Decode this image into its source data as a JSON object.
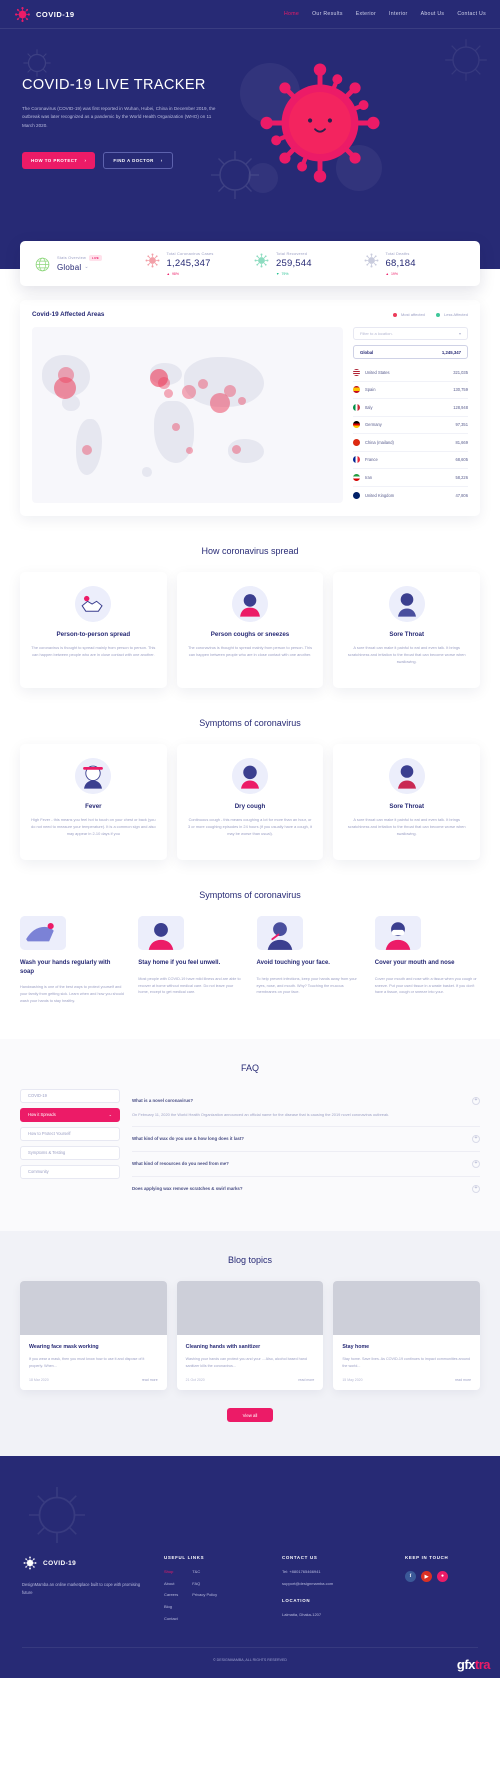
{
  "nav": {
    "brand": "COVID-19",
    "logo_icon": "virus-icon",
    "links": [
      {
        "label": "Home",
        "active": true
      },
      {
        "label": "Our Results",
        "active": false
      },
      {
        "label": "Exterior",
        "active": false
      },
      {
        "label": "Interior",
        "active": false
      },
      {
        "label": "About Us",
        "active": false
      },
      {
        "label": "Contact Us",
        "active": false
      }
    ]
  },
  "hero": {
    "title": "COVID-19 LIVE TRACKER",
    "subtitle": "The Coronavirus (COVID-19) was first reported in Wuhan, Hubei, China in December 2019, the outbreak was later recognized as a pandemic by the World Health Organization (WHO) on 11 March 2020.",
    "primary_button": "HOW TO PROTECT",
    "secondary_button": "FIND A DOCTOR",
    "chevron": "›"
  },
  "stats": {
    "overview_label": "Stats Overview",
    "live_badge": "LIVE",
    "region": "Global",
    "region_caret": "⌄",
    "items": [
      {
        "label": "Total Coronavirus Cases",
        "value": "1,245,347",
        "delta": "98%",
        "direction": "up",
        "icon": "virus-red-icon"
      },
      {
        "label": "Total Recovered",
        "value": "259,544",
        "delta": "79%",
        "direction": "down",
        "icon": "virus-green-icon"
      },
      {
        "label": "Total Deaths",
        "value": "68,184",
        "delta": "19%",
        "direction": "up",
        "icon": "virus-gray-icon"
      }
    ],
    "globe_icon": "globe-icon"
  },
  "map": {
    "title": "Covid-19 Affected Areas",
    "legend": [
      {
        "label": "Most affected",
        "color": "#ec3c5a"
      },
      {
        "label": "Less Affected",
        "color": "#3fc79a"
      }
    ],
    "filter_placeholder": "Filter to a location.",
    "global_row_label": "Global",
    "global_row_value": "1,245,347",
    "countries": [
      {
        "name": "United States",
        "value": "321,035",
        "flag": "us-flag"
      },
      {
        "name": "Spain",
        "value": "130,759",
        "flag": "es-flag"
      },
      {
        "name": "Italy",
        "value": "128,948",
        "flag": "it-flag"
      },
      {
        "name": "Germany",
        "value": "97,351",
        "flag": "de-flag"
      },
      {
        "name": "China (mailand)",
        "value": "81,669",
        "flag": "cn-flag"
      },
      {
        "name": "France",
        "value": "68,605",
        "flag": "fr-flag"
      },
      {
        "name": "Iran",
        "value": "58,226",
        "flag": "ir-flag"
      },
      {
        "name": "United Kingdom",
        "value": "47,806",
        "flag": "gb-flag"
      }
    ]
  },
  "spread": {
    "heading": "How coronavirus spread",
    "cards": [
      {
        "title": "Person-to-person spread",
        "text": "The coronavirus is thought to spread mainly from person to person. This can happen between people who are in close contact with one another.",
        "icon": "handshake-icon"
      },
      {
        "title": "Person coughs or sneezes",
        "text": "The coronavirus is thought to spread mainly from person to person. This can happen between people who are in close contact with one another.",
        "icon": "sneeze-icon"
      },
      {
        "title": "Sore Throat",
        "text": "A sore throat can make it painful to eat and even talk. It brings scratchiness and irritation to the throat that can become worse when swallowing.",
        "icon": "throat-icon"
      }
    ]
  },
  "symptoms": {
    "heading": "Symptoms of coronavirus",
    "cards": [
      {
        "title": "Fever",
        "text": "High Fever - this means you feel hot to touch on your chest or back (you do not need to measure your temperature). It is a common sign and also may appear in 2-10 days if you",
        "icon": "fever-icon"
      },
      {
        "title": "Dry cough",
        "text": "Continuous cough - this means coughing a lot for more than an hour, or 3 or more coughing episodes in 24 hours (if you usually have a cough, it may be worse than usual).",
        "icon": "cough-icon"
      },
      {
        "title": "Sore Throat",
        "text": "A sore throat can make it painful to eat and even talk. It brings scratchiness and irritation to the throat that can become worse when swallowing.",
        "icon": "throat-icon"
      }
    ]
  },
  "prevention": {
    "heading": "Symptoms of coronavirus",
    "cards": [
      {
        "title": "Wash your hands regularly with soap",
        "text": "Handwashing is one of the best ways to protect yourself and your family from getting sick. Learn when and how you should wash your hands to stay healthy.",
        "icon": "wash-hands-icon"
      },
      {
        "title": "Stay home if you feel unwell.",
        "text": "Most people with COVID-19 have mild illness and are able to recover at home without medical care. Do not leave your home, except to get medical care.",
        "icon": "stay-home-icon"
      },
      {
        "title": "Avoid touching your face.",
        "text": "To help prevent infections, keep your hands away from your eyes, nose, and mouth. Why? Touching the mucous membranes on your face.",
        "icon": "avoid-touch-icon"
      },
      {
        "title": "Cover your mouth and nose",
        "text": "Cover your mouth and nose with a tissue when you cough or sneeze. Put your used tissue in a waste basket. If you don't have a tissue, cough or sneeze into your.",
        "icon": "cover-mouth-icon"
      }
    ]
  },
  "faq": {
    "heading": "FAQ",
    "categories": [
      {
        "label": "COVID-19",
        "active": false
      },
      {
        "label": "How it Spreads",
        "active": true
      },
      {
        "label": "How to Protect Yourself",
        "active": false
      },
      {
        "label": "Symptoms & Testing",
        "active": false
      },
      {
        "label": "Community",
        "active": false
      }
    ],
    "active_caret": "⌄",
    "items": [
      {
        "question": "What is a novel coronavirus?",
        "answer": "On February 11, 2020 the World Health Organization announced an official name for the disease that is causing the 2019 novel coronavirus outbreak.",
        "open": true
      },
      {
        "question": "What kind of wax do you use & how long does it last?",
        "answer": "",
        "open": false
      },
      {
        "question": "What kind of resources do you need from me?",
        "answer": "",
        "open": false
      },
      {
        "question": "Does applying wax remove scratches & swirl marks?",
        "answer": "",
        "open": false
      }
    ],
    "toggle_icon": "plus-circle-icon"
  },
  "blog": {
    "heading": "Blog topics",
    "posts": [
      {
        "title": "Wearing face mask working",
        "text": "If you wear a mask, then you must know how to use it and dispose of it properly. When...",
        "date": "18 Mar 2020",
        "read_more": "read more"
      },
      {
        "title": "Cleaning hands with sanitizer",
        "text": "Washing your hands can protect you and your ... Also, alcohol based hand sanitizer kills the coronavirus...",
        "date": "21 Oct 2020",
        "read_more": "read more"
      },
      {
        "title": "Stay home",
        "text": "Stay home. Save lives. As COVID-19 continues to impact communities around the world...",
        "date": "15 May 2020",
        "read_more": "read more"
      }
    ],
    "view_all": "View all"
  },
  "footer": {
    "brand": "COVID-19",
    "tagline": "DesignMamba an online marketplace built to cope with promising future",
    "columns": [
      {
        "heading": "USEFUL LINKS",
        "links": [
          {
            "label": "Shop",
            "pink": true
          },
          {
            "label": "About",
            "pink": false
          },
          {
            "label": "Careers",
            "pink": false
          },
          {
            "label": "Blog",
            "pink": false
          },
          {
            "label": "Contact",
            "pink": false
          }
        ]
      },
      {
        "heading": "",
        "links": [
          {
            "label": "T&C",
            "pink": false
          },
          {
            "label": "FAQ",
            "pink": false
          },
          {
            "label": "Privacy Policy",
            "pink": false
          }
        ]
      }
    ],
    "contact": {
      "heading": "CONTACT US",
      "tel": "Tel: +8801765466941",
      "email": "support@designmamba.com",
      "location_heading": "LOCATION",
      "address": "Lalmatia, Dhaka-1207"
    },
    "social": {
      "heading": "KEEP IN TOUCH",
      "icons": [
        {
          "name": "facebook-icon",
          "glyph": "f"
        },
        {
          "name": "youtube-icon",
          "glyph": "▶"
        },
        {
          "name": "dribbble-icon",
          "glyph": "●"
        }
      ]
    },
    "copyright": "© DESIGNMAMBA, ALL RIGHTS RESERVED",
    "watermark": "gfxtra"
  }
}
